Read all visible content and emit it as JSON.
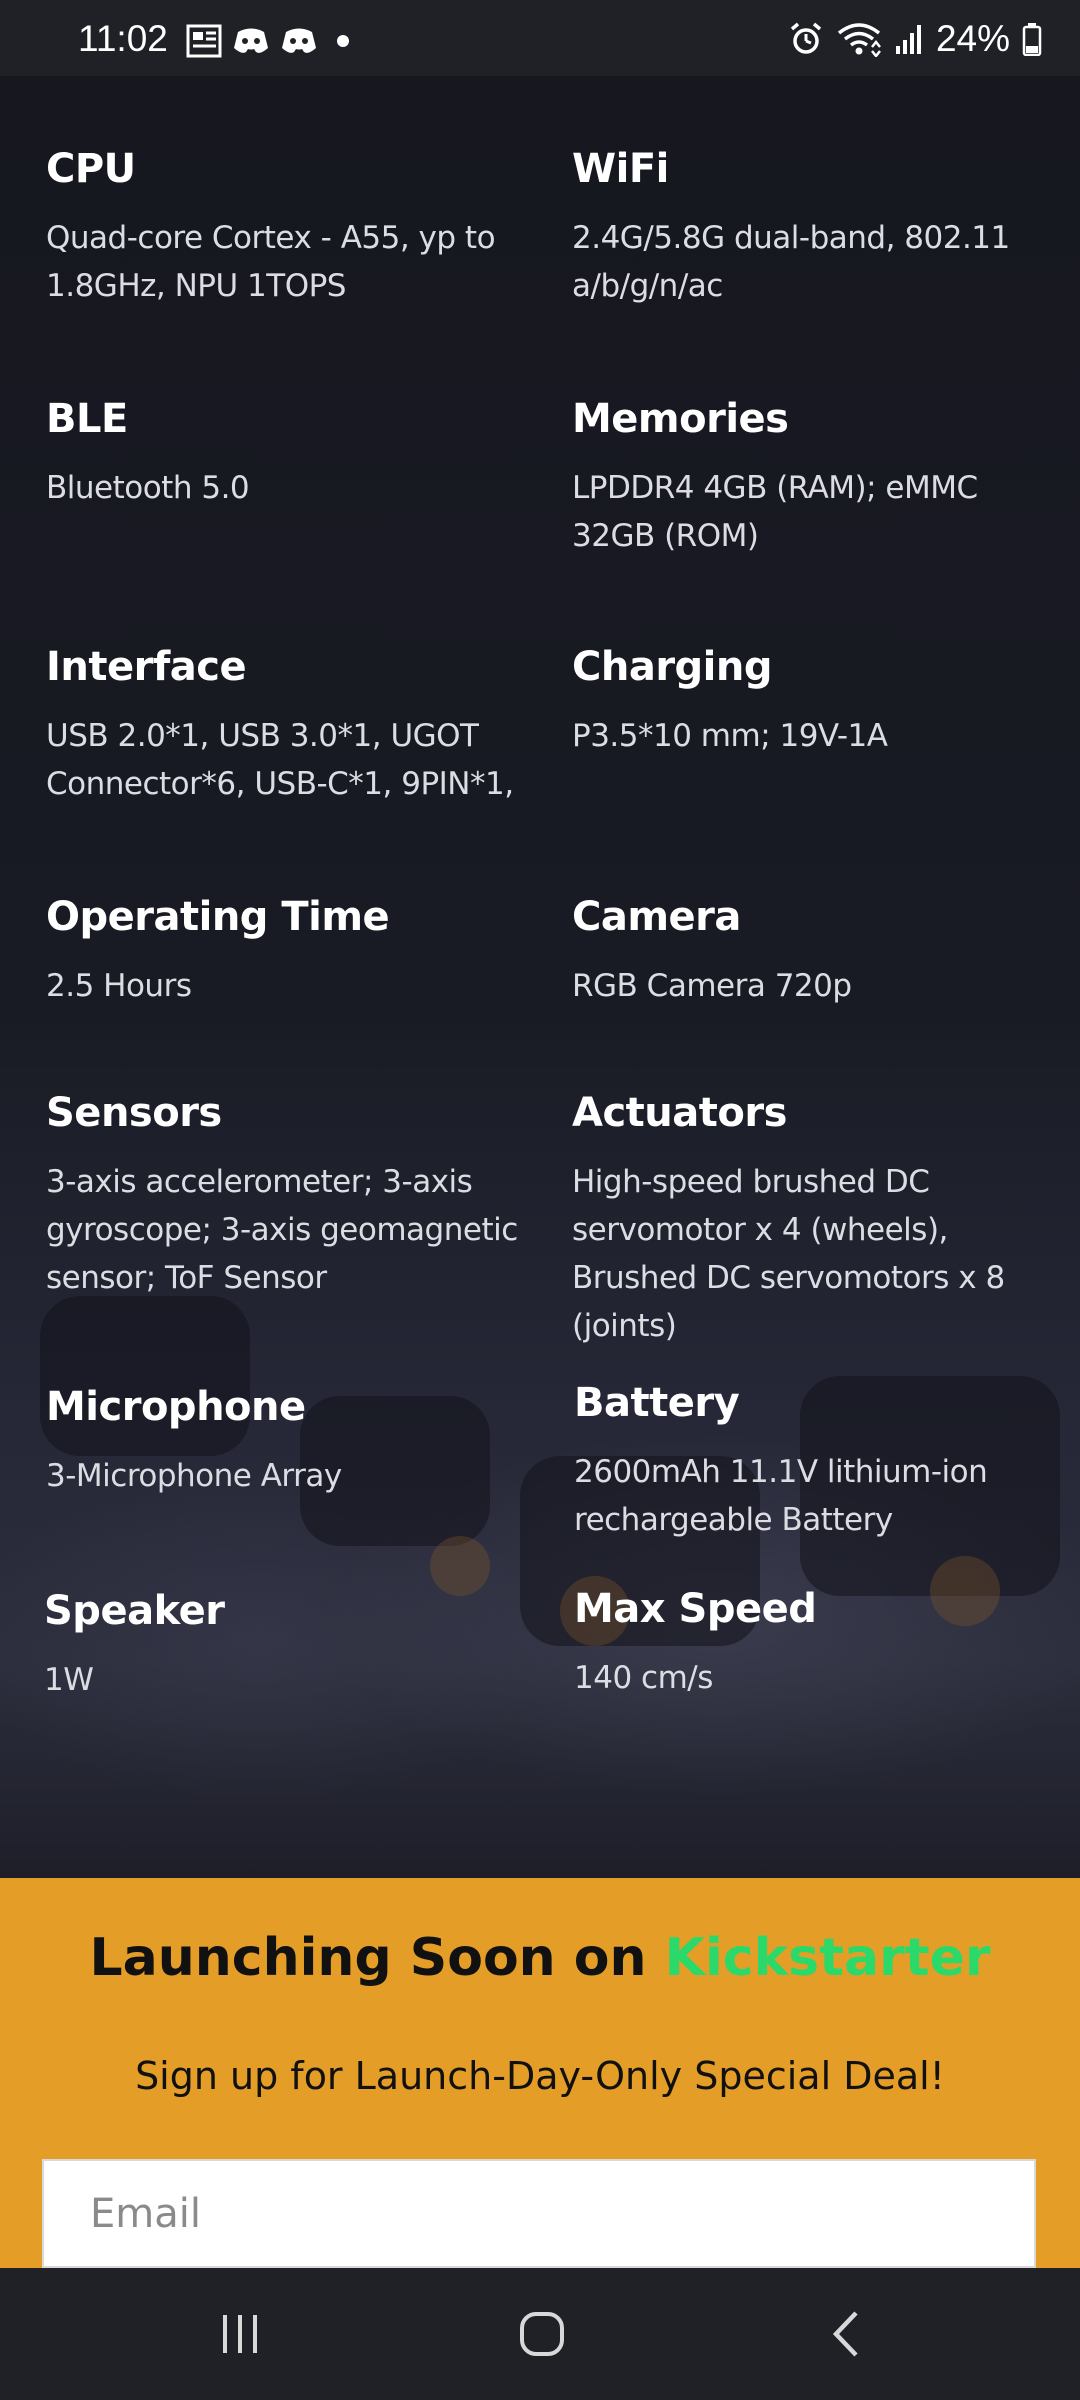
{
  "status_bar": {
    "time": "11:02",
    "battery_text": "24%",
    "icons_left": [
      "news-icon",
      "discord-icon",
      "discord-icon",
      "dot-icon"
    ],
    "icons_right": [
      "alarm-icon",
      "wifi-icon",
      "signal-icon",
      "battery-icon"
    ]
  },
  "specs": [
    {
      "title": "CPU",
      "value": "Quad-core Cortex - A55, yp to 1.8GHz, NPU 1TOPS"
    },
    {
      "title": "WiFi",
      "value": "2.4G/5.8G dual-band, 802.11 a/b/g/n/ac"
    },
    {
      "title": "BLE",
      "value": "Bluetooth 5.0"
    },
    {
      "title": "Memories",
      "value": "LPDDR4 4GB (RAM); eMMC 32GB (ROM)"
    },
    {
      "title": "Interface",
      "value": "USB 2.0*1, USB 3.0*1, UGOT Connector*6, USB-C*1, 9PIN*1,"
    },
    {
      "title": "Charging",
      "value": "P3.5*10 mm; 19V-1A"
    },
    {
      "title": "Operating Time",
      "value": "2.5 Hours"
    },
    {
      "title": "Camera",
      "value": "RGB Camera 720p"
    },
    {
      "title": "Sensors",
      "value": "3-axis accelerometer; 3-axis gyroscope; 3-axis geomagnetic sensor; ToF Sensor"
    },
    {
      "title": "Actuators",
      "value": "High-speed brushed DC servomotor x 4 (wheels), Brushed DC servomotors x 8 (joints)"
    },
    {
      "title": "Microphone",
      "value": "3-Microphone Array"
    },
    {
      "title": "Battery",
      "value": "2600mAh 11.1V lithium-ion rechargeable Battery"
    },
    {
      "title": "Speaker",
      "value": "1W"
    },
    {
      "title": "Max Speed",
      "value": "140 cm/s"
    }
  ],
  "signup": {
    "title_prefix": "Launching Soon on ",
    "title_highlight": "Kickstarter",
    "subtitle": "Sign up for Launch-Day-Only Special Deal!",
    "email_placeholder": "Email"
  },
  "colors": {
    "background": "#16171f",
    "signup_background": "#e49d27",
    "kickstarter_green": "#2bd96a"
  },
  "nav_bar": {
    "buttons": [
      "recents-icon",
      "home-icon",
      "back-icon"
    ]
  }
}
